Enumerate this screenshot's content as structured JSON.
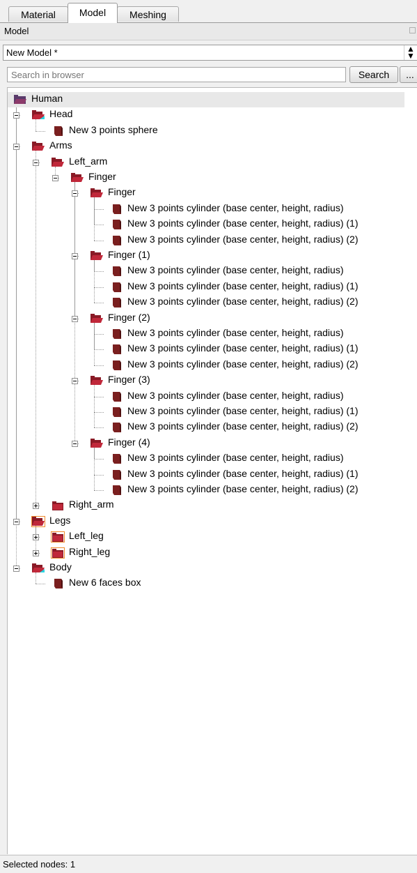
{
  "tabs": [
    {
      "label": "Material",
      "active": false
    },
    {
      "label": "Model",
      "active": true
    },
    {
      "label": "Meshing",
      "active": false
    }
  ],
  "dock": {
    "title": "Model"
  },
  "model_select": {
    "value": "New Model *"
  },
  "search": {
    "placeholder": "Search in browser",
    "button": "Search",
    "more": "..."
  },
  "colors": {
    "folder": "#c0283a",
    "folder_dark": "#8a1a26",
    "solid": "#7a1f1f",
    "accent_cyan": "#29d3e0",
    "highlight": "#f08a2c"
  },
  "tree": [
    {
      "label": "Human",
      "depth": 0,
      "icon": "folder-open-icon",
      "selected": true
    },
    {
      "label": "Head",
      "depth": 1,
      "icon": "folder-open-icon",
      "toggle": "minus",
      "accent": "cyan"
    },
    {
      "label": "New 3 points sphere",
      "depth": 2,
      "icon": "solid-icon"
    },
    {
      "label": "Arms",
      "depth": 1,
      "icon": "folder-open-icon",
      "toggle": "minus"
    },
    {
      "label": "Left_arm",
      "depth": 2,
      "icon": "folder-open-icon",
      "toggle": "minus"
    },
    {
      "label": "Finger",
      "depth": 3,
      "icon": "folder-open-icon",
      "toggle": "minus"
    },
    {
      "label": "Finger",
      "depth": 4,
      "icon": "folder-open-icon",
      "toggle": "minus"
    },
    {
      "label": "New 3 points cylinder (base center, height, radius)",
      "depth": 5,
      "icon": "solid-icon"
    },
    {
      "label": "New 3 points cylinder (base center, height, radius) (1)",
      "depth": 5,
      "icon": "solid-icon"
    },
    {
      "label": "New 3 points cylinder (base center, height, radius) (2)",
      "depth": 5,
      "icon": "solid-icon"
    },
    {
      "label": "Finger (1)",
      "depth": 4,
      "icon": "folder-open-icon",
      "toggle": "minus"
    },
    {
      "label": "New 3 points cylinder (base center, height, radius)",
      "depth": 5,
      "icon": "solid-icon"
    },
    {
      "label": "New 3 points cylinder (base center, height, radius) (1)",
      "depth": 5,
      "icon": "solid-icon"
    },
    {
      "label": "New 3 points cylinder (base center, height, radius) (2)",
      "depth": 5,
      "icon": "solid-icon"
    },
    {
      "label": "Finger (2)",
      "depth": 4,
      "icon": "folder-open-icon",
      "toggle": "minus"
    },
    {
      "label": "New 3 points cylinder (base center, height, radius)",
      "depth": 5,
      "icon": "solid-icon"
    },
    {
      "label": "New 3 points cylinder (base center, height, radius) (1)",
      "depth": 5,
      "icon": "solid-icon"
    },
    {
      "label": "New 3 points cylinder (base center, height, radius) (2)",
      "depth": 5,
      "icon": "solid-icon"
    },
    {
      "label": "Finger (3)",
      "depth": 4,
      "icon": "folder-open-icon",
      "toggle": "minus"
    },
    {
      "label": "New 3 points cylinder (base center, height, radius)",
      "depth": 5,
      "icon": "solid-icon"
    },
    {
      "label": "New 3 points cylinder (base center, height, radius) (1)",
      "depth": 5,
      "icon": "solid-icon"
    },
    {
      "label": "New 3 points cylinder (base center, height, radius) (2)",
      "depth": 5,
      "icon": "solid-icon"
    },
    {
      "label": "Finger (4)",
      "depth": 4,
      "icon": "folder-open-icon",
      "toggle": "minus"
    },
    {
      "label": "New 3 points cylinder (base center, height, radius)",
      "depth": 5,
      "icon": "solid-icon"
    },
    {
      "label": "New 3 points cylinder (base center, height, radius) (1)",
      "depth": 5,
      "icon": "solid-icon"
    },
    {
      "label": "New 3 points cylinder (base center, height, radius) (2)",
      "depth": 5,
      "icon": "solid-icon"
    },
    {
      "label": "Right_arm",
      "depth": 2,
      "icon": "folder-closed-icon",
      "toggle": "plus"
    },
    {
      "label": "Legs",
      "depth": 1,
      "icon": "folder-open-icon",
      "toggle": "minus",
      "accent": "orange"
    },
    {
      "label": "Left_leg",
      "depth": 2,
      "icon": "folder-closed-icon",
      "toggle": "plus",
      "accent": "orange"
    },
    {
      "label": "Right_leg",
      "depth": 2,
      "icon": "folder-closed-icon",
      "toggle": "plus",
      "accent": "orange"
    },
    {
      "label": "Body",
      "depth": 1,
      "icon": "folder-open-icon",
      "toggle": "minus",
      "accent": "cyan"
    },
    {
      "label": "New 6 faces box",
      "depth": 2,
      "icon": "solid-icon"
    }
  ],
  "status": {
    "text": "Selected nodes: 1"
  }
}
